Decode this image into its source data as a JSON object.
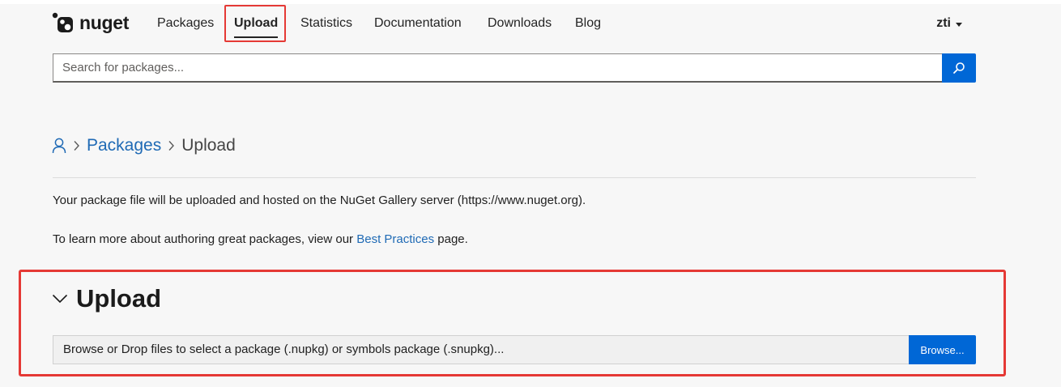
{
  "header": {
    "logo_text": "nuget",
    "nav": [
      {
        "label": "Packages"
      },
      {
        "label": "Upload"
      },
      {
        "label": "Statistics"
      },
      {
        "label": "Documentation"
      },
      {
        "label": "Downloads"
      },
      {
        "label": "Blog"
      }
    ],
    "active_nav": "Upload",
    "user": "zti"
  },
  "search": {
    "placeholder": "Search for packages...",
    "value": ""
  },
  "breadcrumb": {
    "home_icon": "person-icon",
    "items": [
      "Packages",
      "Upload"
    ]
  },
  "info": {
    "line1": "Your package file will be uploaded and hosted on the NuGet Gallery server (https://www.nuget.org).",
    "line2_prefix": "To learn more about authoring great packages, view our ",
    "line2_link": "Best Practices",
    "line2_suffix": " page."
  },
  "upload": {
    "title": "Upload",
    "drop_text": "Browse or Drop files to select a package (.nupkg) or symbols package (.snupkg)...",
    "browse_label": "Browse..."
  },
  "colors": {
    "accent": "#0067d6",
    "link": "#1f6ab5",
    "highlight": "#e53935"
  }
}
